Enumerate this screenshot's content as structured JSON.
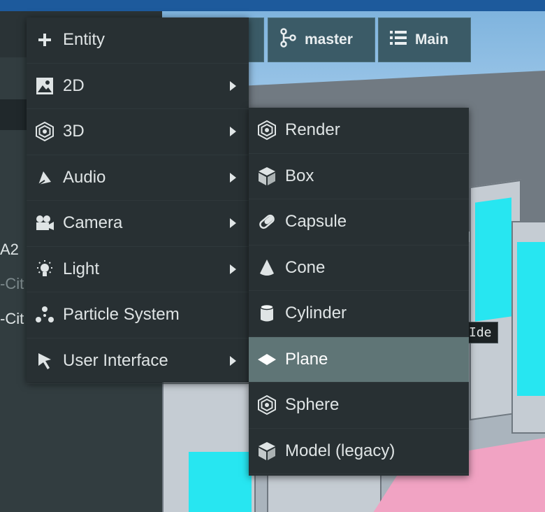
{
  "colors": {
    "menu_bg": "#283033",
    "menu_active_bg": "#5f7576",
    "toolbar_button_bg": "#3b5b67",
    "top_strip": "#1d5a9c",
    "accent_cyan": "#27e6f1",
    "accent_pink": "#f1a3c3"
  },
  "toolbar": {
    "branch_button": {
      "label": "master",
      "icon": "git-branch-icon"
    },
    "scene_button": {
      "label": "Main",
      "icon": "list-icon"
    }
  },
  "hierarchy_fragments": [
    "A2",
    "-Cit",
    "-Cit"
  ],
  "viewport_tooltip": "Ide",
  "main_menu": {
    "items": [
      {
        "label": "Entity",
        "icon": "plus-icon",
        "has_submenu": false
      },
      {
        "label": "2D",
        "icon": "image-icon",
        "has_submenu": true
      },
      {
        "label": "3D",
        "icon": "hexagon-icon",
        "has_submenu": true
      },
      {
        "label": "Audio",
        "icon": "speaker-icon",
        "has_submenu": true
      },
      {
        "label": "Camera",
        "icon": "camera-icon",
        "has_submenu": true
      },
      {
        "label": "Light",
        "icon": "lightbulb-icon",
        "has_submenu": true
      },
      {
        "label": "Particle System",
        "icon": "particles-icon",
        "has_submenu": false
      },
      {
        "label": "User Interface",
        "icon": "cursor-icon",
        "has_submenu": true
      }
    ]
  },
  "submenu_3d": {
    "items": [
      {
        "label": "Render",
        "icon": "hexagon-icon"
      },
      {
        "label": "Box",
        "icon": "cube-icon"
      },
      {
        "label": "Capsule",
        "icon": "capsule-icon"
      },
      {
        "label": "Cone",
        "icon": "cone-icon"
      },
      {
        "label": "Cylinder",
        "icon": "cylinder-icon"
      },
      {
        "label": "Plane",
        "icon": "plane-icon",
        "highlighted": true
      },
      {
        "label": "Sphere",
        "icon": "hexagon-icon"
      },
      {
        "label": "Model (legacy)",
        "icon": "cube-icon"
      }
    ]
  }
}
